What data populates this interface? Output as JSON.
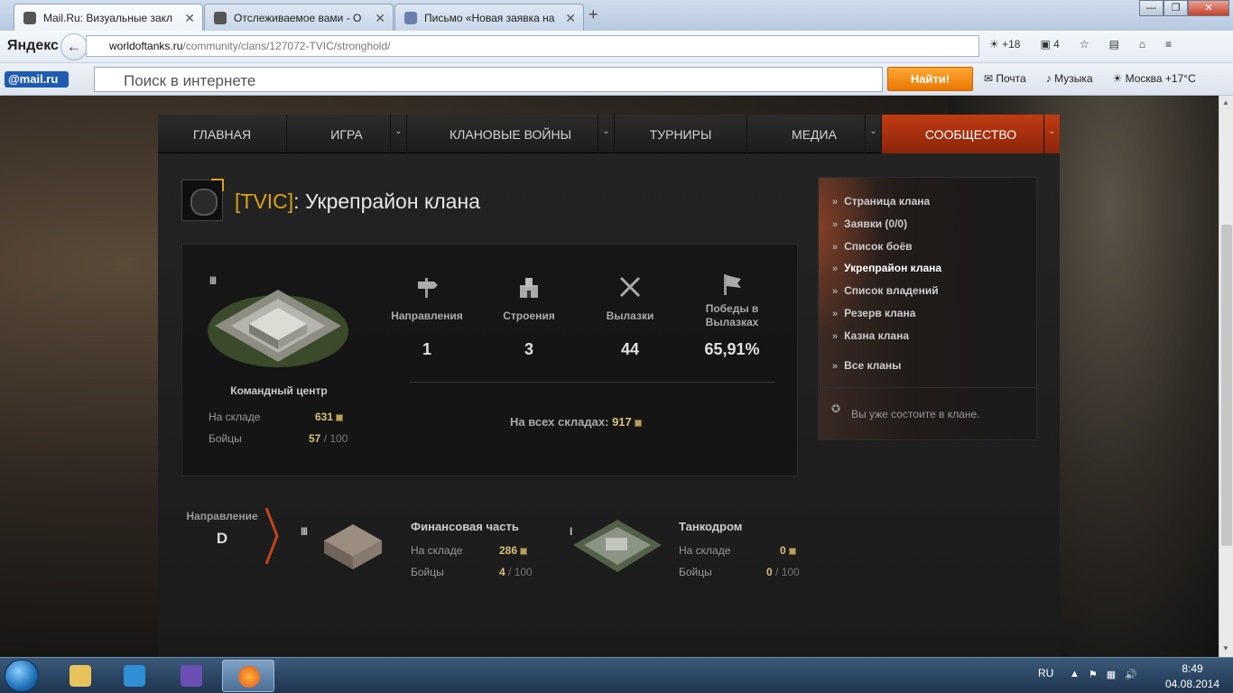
{
  "browser": {
    "tabs": [
      {
        "title": "Mail.Ru: Визуальные закл"
      },
      {
        "title": "Отслеживаемое вами - О"
      },
      {
        "title": "Письмо «Новая заявка на"
      }
    ],
    "yandex_logo": "Яндекс",
    "url_host": "worldoftanks.ru",
    "url_path": "/community/clans/127072-TVIC/stronghold/",
    "weather_badge": "+18",
    "notif_count": "4",
    "mailru_logo": "@mail.ru",
    "search_placeholder": "Поиск в интернете",
    "search_button": "Найти!",
    "mail_link": "Почта",
    "music_link": "Музыка",
    "weather_link": "Москва +17°C"
  },
  "site": {
    "menu": [
      {
        "label": "ГЛАВНАЯ"
      },
      {
        "label": "ИГРА"
      },
      {
        "label": "КЛАНОВЫЕ ВОЙНЫ"
      },
      {
        "label": "ТУРНИРЫ"
      },
      {
        "label": "МЕДИА"
      },
      {
        "label": "СООБЩЕСТВО"
      }
    ],
    "clan_tag": "[TVIC]",
    "clan_title_rest": ": Укрепрайон клана",
    "hq": {
      "level": "III",
      "name": "Командный центр",
      "stock_label": "На складе",
      "stock_value": "631",
      "fighters_label": "Бойцы",
      "fighters_value": "57",
      "fighters_max": " / 100"
    },
    "stats": [
      {
        "label": "Направления",
        "value": "1",
        "icon": "signpost-icon"
      },
      {
        "label": "Строения",
        "value": "3",
        "icon": "fortress-icon"
      },
      {
        "label": "Вылазки",
        "value": "44",
        "icon": "crossed-swords-icon"
      },
      {
        "label": "Победы в Вылазках",
        "value": "65,91%",
        "icon": "flag-icon"
      }
    ],
    "all_stock_label": "На всех складах:",
    "all_stock_value": "917",
    "direction": {
      "label": "Направление",
      "value": "D"
    },
    "buildings": [
      {
        "level": "III",
        "name": "Финансовая часть",
        "stock_label": "На складе",
        "stock_value": "286",
        "fighters_label": "Бойцы",
        "fighters_value": "4",
        "fighters_max": " / 100"
      },
      {
        "level": "I",
        "name": "Танкодром",
        "stock_label": "На складе",
        "stock_value": "0",
        "fighters_label": "Бойцы",
        "fighters_value": "0",
        "fighters_max": " / 100"
      }
    ],
    "sidebar": {
      "items": [
        {
          "label": "Страница клана"
        },
        {
          "label": "Заявки (0/0)"
        },
        {
          "label": "Список боёв"
        },
        {
          "label": "Укрепрайон клана"
        },
        {
          "label": "Список владений"
        },
        {
          "label": "Резерв клана"
        },
        {
          "label": "Казна клана"
        },
        {
          "label": "Все кланы"
        }
      ],
      "note": "Вы уже состоите в клане."
    }
  },
  "taskbar": {
    "lang": "RU",
    "time": "8:49",
    "date": "04.08.2014"
  },
  "colors": {
    "accent": "#c23c12",
    "gold": "#d9a21b",
    "resource": "#d6c07a"
  }
}
